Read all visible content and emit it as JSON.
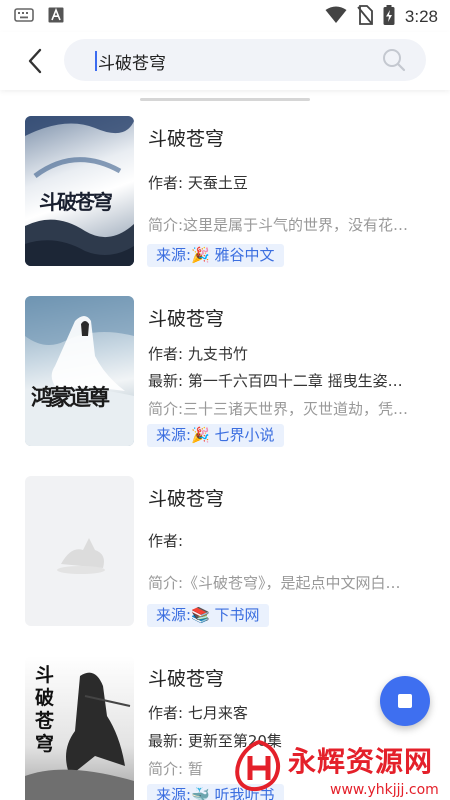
{
  "status_bar": {
    "time": "3:28"
  },
  "search": {
    "query": "斗破苍穹"
  },
  "books": [
    {
      "title": "斗破苍穹",
      "author": "作者: 天蚕土豆",
      "intro": "简介:这里是属于斗气的世界，没有花…",
      "source": "来源:🎉 雅谷中文",
      "cover_text": "斗破苍穹"
    },
    {
      "title": "斗破苍穹",
      "author": "作者: 九支书竹",
      "latest": "最新: 第一千六百四十二章 摇曳生姿…",
      "intro": "简介:三十三诸天世界，灭世道劫，凭…",
      "source": "来源:🎉 七界小说",
      "cover_text": "鸿蒙道尊"
    },
    {
      "title": "斗破苍穹",
      "author": "作者:",
      "intro": "简介:《斗破苍穹》，是起点中文网白…",
      "source": "来源:📚 下书网"
    },
    {
      "title": "斗破苍穹",
      "author": "作者: 七月来客",
      "latest": "最新: 更新至第20集",
      "intro": "简介: 暂",
      "source": "来源:🐳 听我听书",
      "cover_text": "斗破苍穹"
    }
  ],
  "watermark": {
    "text": "永辉资源网",
    "url": "www.yhkjjj.com"
  }
}
